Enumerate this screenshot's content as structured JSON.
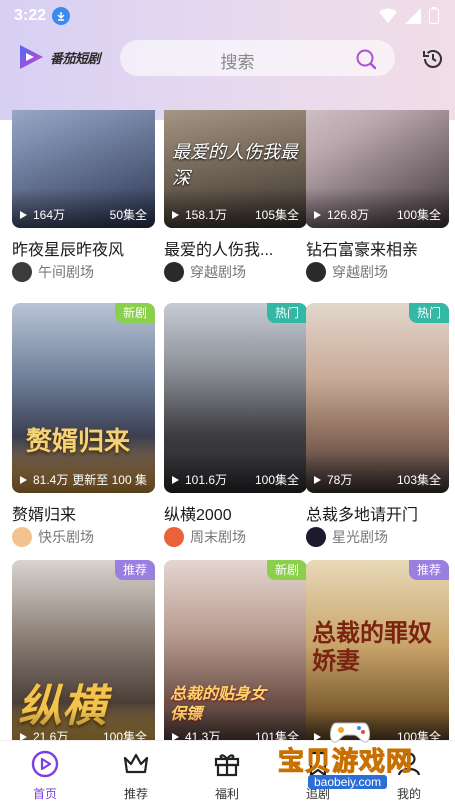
{
  "status_bar": {
    "time": "3:22"
  },
  "header": {
    "logo_text": "番茄短剧",
    "search_placeholder": "搜索"
  },
  "colors": {
    "accent": "#7b3fe4",
    "badge_new": "#8ad04c",
    "badge_hot": "#34b8a6",
    "badge_rec": "#9a7ee0"
  },
  "cards": [
    {
      "title": "昨夜星辰昨夜风",
      "views": "164万",
      "episodes": "50集全",
      "source": "午间剧场",
      "badge": ""
    },
    {
      "title": "最爱的人伤我...",
      "views": "158.1万",
      "episodes": "105集全",
      "source": "穿越剧场",
      "badge": ""
    },
    {
      "title": "钻石富豪来相亲",
      "views": "126.8万",
      "episodes": "100集全",
      "source": "穿越剧场",
      "badge": ""
    },
    {
      "title": "赘婿归来",
      "views": "81.4万",
      "episodes": "更新至 100 集",
      "source": "快乐剧场",
      "badge": "新剧"
    },
    {
      "title": "纵横2000",
      "views": "101.6万",
      "episodes": "100集全",
      "source": "周末剧场",
      "badge": "热门"
    },
    {
      "title": "总裁多地请开门",
      "views": "78万",
      "episodes": "103集全",
      "source": "星光剧场",
      "badge": "热门"
    },
    {
      "title": "",
      "views": "21.6万",
      "episodes": "100集全",
      "source": "",
      "badge": "推荐",
      "poster_text": "纵横"
    },
    {
      "title": "",
      "views": "41.3万",
      "episodes": "101集全",
      "source": "",
      "badge": "新剧",
      "poster_text": "总裁的贴身女保镖"
    },
    {
      "title": "",
      "views": "",
      "episodes": "100集全",
      "source": "",
      "badge": "推荐",
      "poster_text": "总裁的罪奴娇妻"
    }
  ],
  "poster_captions": {
    "card1": "最爱的人伤我最深",
    "card4": "赘婿归来"
  },
  "tabs": [
    {
      "label": "首页",
      "icon": "play-circle-icon",
      "active": true
    },
    {
      "label": "推荐",
      "icon": "crown-icon",
      "active": false
    },
    {
      "label": "福利",
      "icon": "gift-icon",
      "active": false
    },
    {
      "label": "追剧",
      "icon": "bookmark-icon",
      "active": false
    },
    {
      "label": "我的",
      "icon": "user-icon",
      "active": false
    }
  ],
  "watermark": {
    "text": "宝贝游戏网",
    "url": "baobeiy.com"
  }
}
